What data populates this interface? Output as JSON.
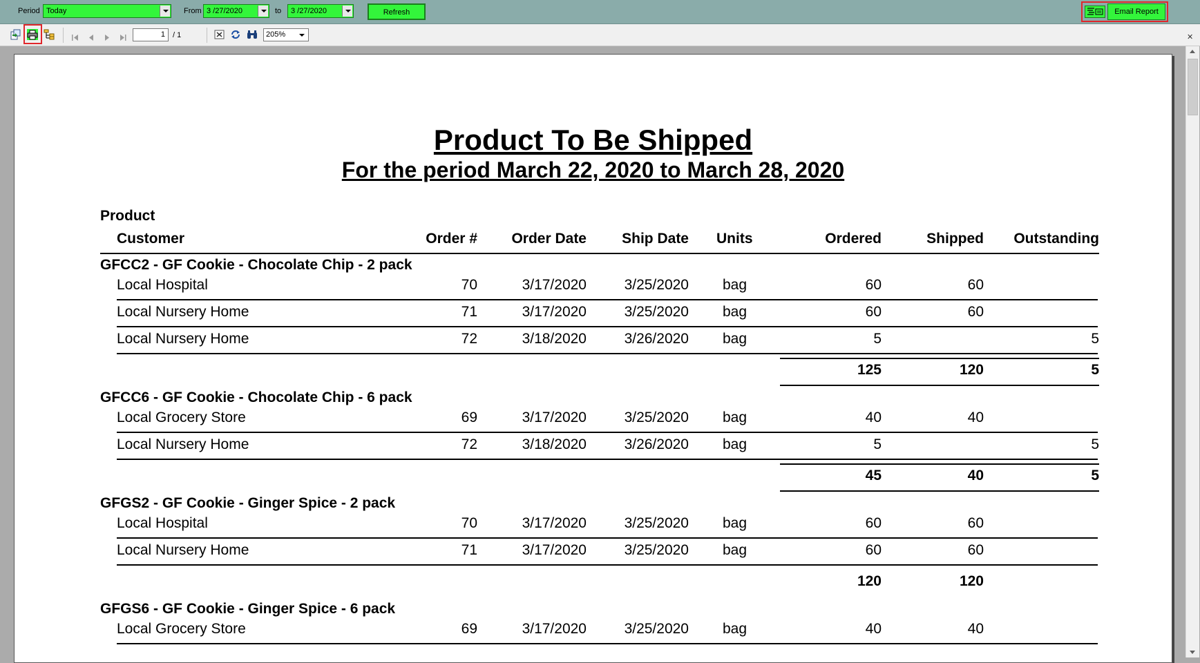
{
  "filter": {
    "period_label": "Period",
    "period_value": "Today",
    "from_label": "From",
    "from_value": "3 /27/2020",
    "to_label": "to",
    "to_value": "3 /27/2020",
    "refresh_label": "Refresh",
    "email_label": "Email Report"
  },
  "toolbar": {
    "page_current": "1",
    "page_total": "/ 1",
    "zoom": "205%",
    "close_glyph": "✕"
  },
  "colors": {
    "filter_bar": "#8aacaa",
    "control_green": "#33f53b",
    "highlight_red": "#e0262b"
  },
  "report": {
    "title": "Product To Be Shipped",
    "subtitle": "For the period March 22, 2020 to March 28, 2020",
    "header": {
      "product": "Product",
      "customer": "Customer",
      "order": "Order #",
      "order_date": "Order Date",
      "ship_date": "Ship Date",
      "units": "Units",
      "ordered": "Ordered",
      "shipped": "Shipped",
      "outstanding": "Outstanding"
    },
    "groups": [
      {
        "name": "GFCC2 - GF Cookie - Chocolate Chip - 2 pack",
        "rows": [
          {
            "customer": "Local Hospital",
            "order": "70",
            "order_date": "3/17/2020",
            "ship_date": "3/25/2020",
            "units": "bag",
            "ordered": "60",
            "shipped": "60",
            "outstanding": ""
          },
          {
            "customer": "Local Nursery Home",
            "order": "71",
            "order_date": "3/17/2020",
            "ship_date": "3/25/2020",
            "units": "bag",
            "ordered": "60",
            "shipped": "60",
            "outstanding": ""
          },
          {
            "customer": "Local Nursery Home",
            "order": "72",
            "order_date": "3/18/2020",
            "ship_date": "3/26/2020",
            "units": "bag",
            "ordered": "5",
            "shipped": "",
            "outstanding": "5"
          }
        ],
        "total": {
          "ordered": "125",
          "shipped": "120",
          "outstanding": "5"
        }
      },
      {
        "name": "GFCC6 - GF Cookie - Chocolate Chip - 6 pack",
        "rows": [
          {
            "customer": "Local Grocery Store",
            "order": "69",
            "order_date": "3/17/2020",
            "ship_date": "3/25/2020",
            "units": "bag",
            "ordered": "40",
            "shipped": "40",
            "outstanding": ""
          },
          {
            "customer": "Local Nursery Home",
            "order": "72",
            "order_date": "3/18/2020",
            "ship_date": "3/26/2020",
            "units": "bag",
            "ordered": "5",
            "shipped": "",
            "outstanding": "5"
          }
        ],
        "total": {
          "ordered": "45",
          "shipped": "40",
          "outstanding": "5"
        }
      },
      {
        "name": "GFGS2 - GF Cookie - Ginger Spice - 2 pack",
        "rows": [
          {
            "customer": "Local Hospital",
            "order": "70",
            "order_date": "3/17/2020",
            "ship_date": "3/25/2020",
            "units": "bag",
            "ordered": "60",
            "shipped": "60",
            "outstanding": ""
          },
          {
            "customer": "Local Nursery Home",
            "order": "71",
            "order_date": "3/17/2020",
            "ship_date": "3/25/2020",
            "units": "bag",
            "ordered": "60",
            "shipped": "60",
            "outstanding": ""
          }
        ],
        "total": {
          "ordered": "120",
          "shipped": "120",
          "outstanding": ""
        }
      },
      {
        "name": "GFGS6 - GF Cookie - Ginger Spice - 6 pack",
        "rows": [
          {
            "customer": "Local Grocery Store",
            "order": "69",
            "order_date": "3/17/2020",
            "ship_date": "3/25/2020",
            "units": "bag",
            "ordered": "40",
            "shipped": "40",
            "outstanding": ""
          }
        ]
      }
    ]
  }
}
